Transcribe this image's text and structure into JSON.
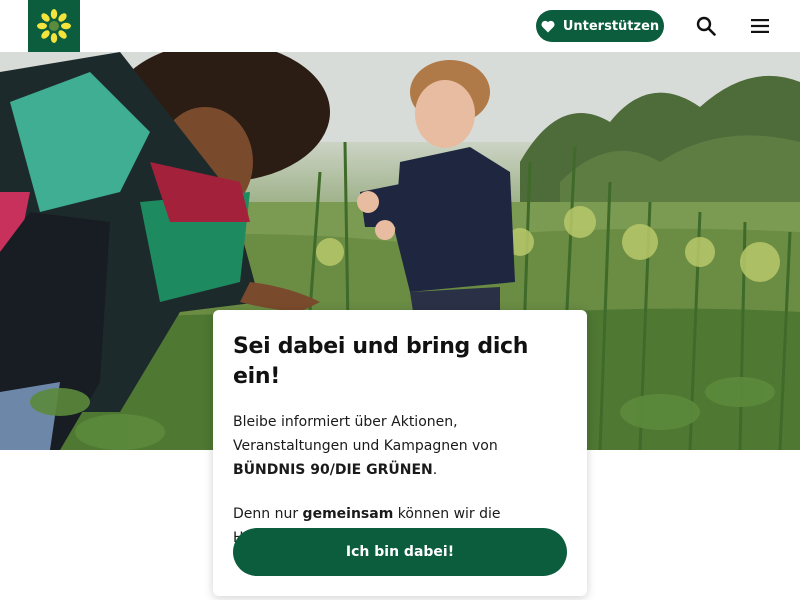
{
  "header": {
    "logo_name": "sunflower-logo",
    "support_label": "Unterstützen",
    "support_icon": "heart-icon",
    "search_icon": "search-icon",
    "menu_icon": "menu-icon"
  },
  "hero": {
    "image": "woman-and-child-in-garden-photo"
  },
  "card": {
    "title": "Sei dabei und bring dich ein!",
    "paragraph1": {
      "text_before": "Bleibe informiert über Aktionen, Veranstaltungen und Kampagnen von ",
      "bold": "BÜNDNIS 90/DIE GRÜNEN",
      "text_after": "."
    },
    "paragraph2": {
      "text_before": "Denn nur ",
      "bold": "gemeinsam",
      "text_after": " können wir die Herausforderungen unserer Zeit stemmen!"
    },
    "cta_label": "Ich bin dabei!"
  },
  "colors": {
    "brand_green": "#0b5d3e",
    "sunflower_yellow": "#f3e33b"
  }
}
